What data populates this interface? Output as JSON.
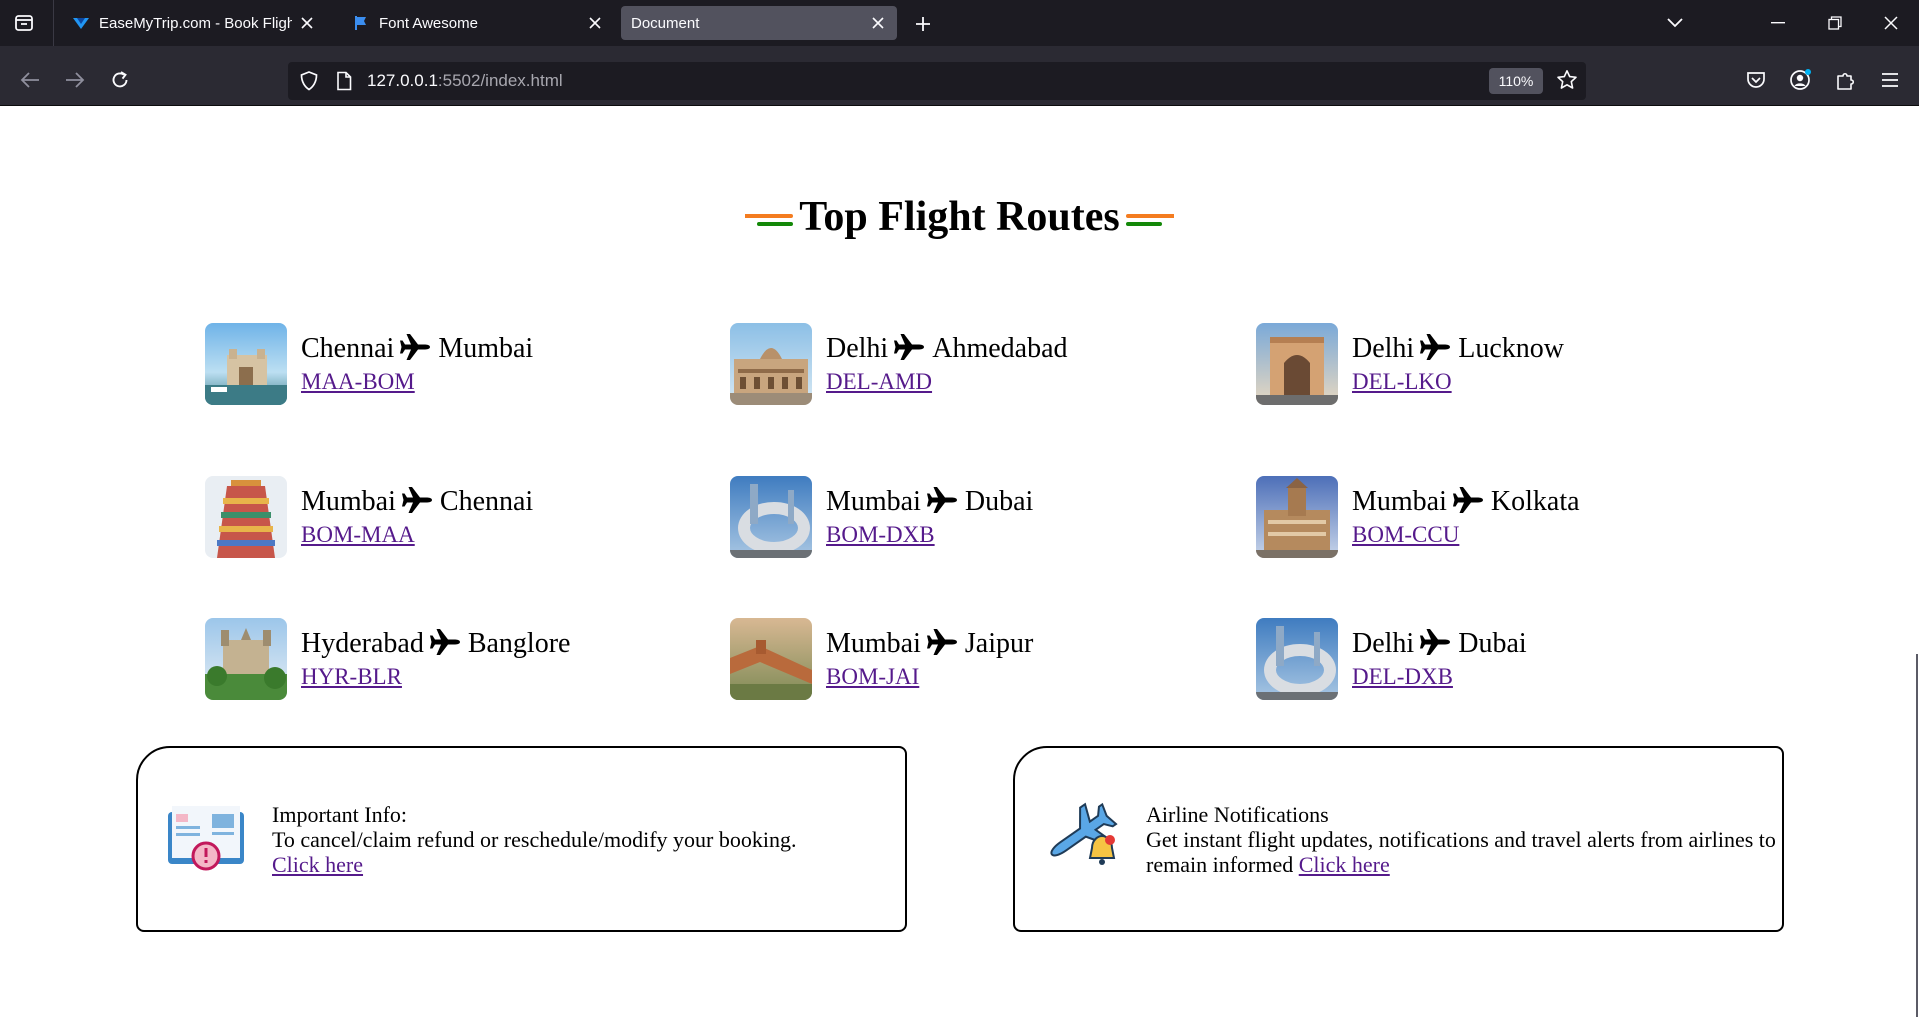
{
  "browser": {
    "tabs": [
      {
        "title": "EaseMyTrip.com - Book Flights,",
        "favicon": "easemytrip-icon"
      },
      {
        "title": "Font Awesome",
        "favicon": "font-awesome-flag-icon"
      },
      {
        "title": "Document",
        "favicon": "",
        "active": true
      }
    ],
    "url_host": "127.0.0.1",
    "url_rest": ":5502/index.html",
    "zoom": "110%"
  },
  "page": {
    "heading": "Top Flight Routes",
    "routes": [
      {
        "from": "Chennai",
        "to": "Mumbai",
        "code": "MAA-BOM",
        "image": "gateway-of-india"
      },
      {
        "from": "Delhi",
        "to": "Ahmedabad",
        "code": "DEL-AMD",
        "image": "ahmedabad-building"
      },
      {
        "from": "Delhi",
        "to": "Lucknow",
        "code": "DEL-LKO",
        "image": "rumi-darwaza"
      },
      {
        "from": "Mumbai",
        "to": "Chennai",
        "code": "BOM-MAA",
        "image": "temple-gopuram"
      },
      {
        "from": "Mumbai",
        "to": "Dubai",
        "code": "BOM-DXB",
        "image": "museum-of-future"
      },
      {
        "from": "Mumbai",
        "to": "Kolkata",
        "code": "BOM-CCU",
        "image": "kolkata-building"
      },
      {
        "from": "Hyderabad",
        "to": "Banglore",
        "code": "HYR-BLR",
        "image": "bangalore-palace"
      },
      {
        "from": "Mumbai",
        "to": "Jaipur",
        "code": "BOM-JAI",
        "image": "jaipur-fort"
      },
      {
        "from": "Delhi",
        "to": "Dubai",
        "code": "DEL-DXB",
        "image": "museum-of-future"
      }
    ],
    "info_cards": [
      {
        "title": "Important Info:",
        "body": "To cancel/claim refund or reschedule/modify your booking.",
        "link": "Click here",
        "icon": "booking-book-icon"
      },
      {
        "title": "Airline Notifications",
        "body": "Get instant flight updates, notifications and travel alerts from airlines to remain informed",
        "link": "Click here",
        "icon": "airplane-bell-icon"
      }
    ]
  },
  "colors": {
    "saffron": "#f47c20",
    "green": "#138808",
    "link": "#551a8b",
    "chrome_dark": "#1c1b22",
    "chrome_mid": "#2b2a33"
  }
}
